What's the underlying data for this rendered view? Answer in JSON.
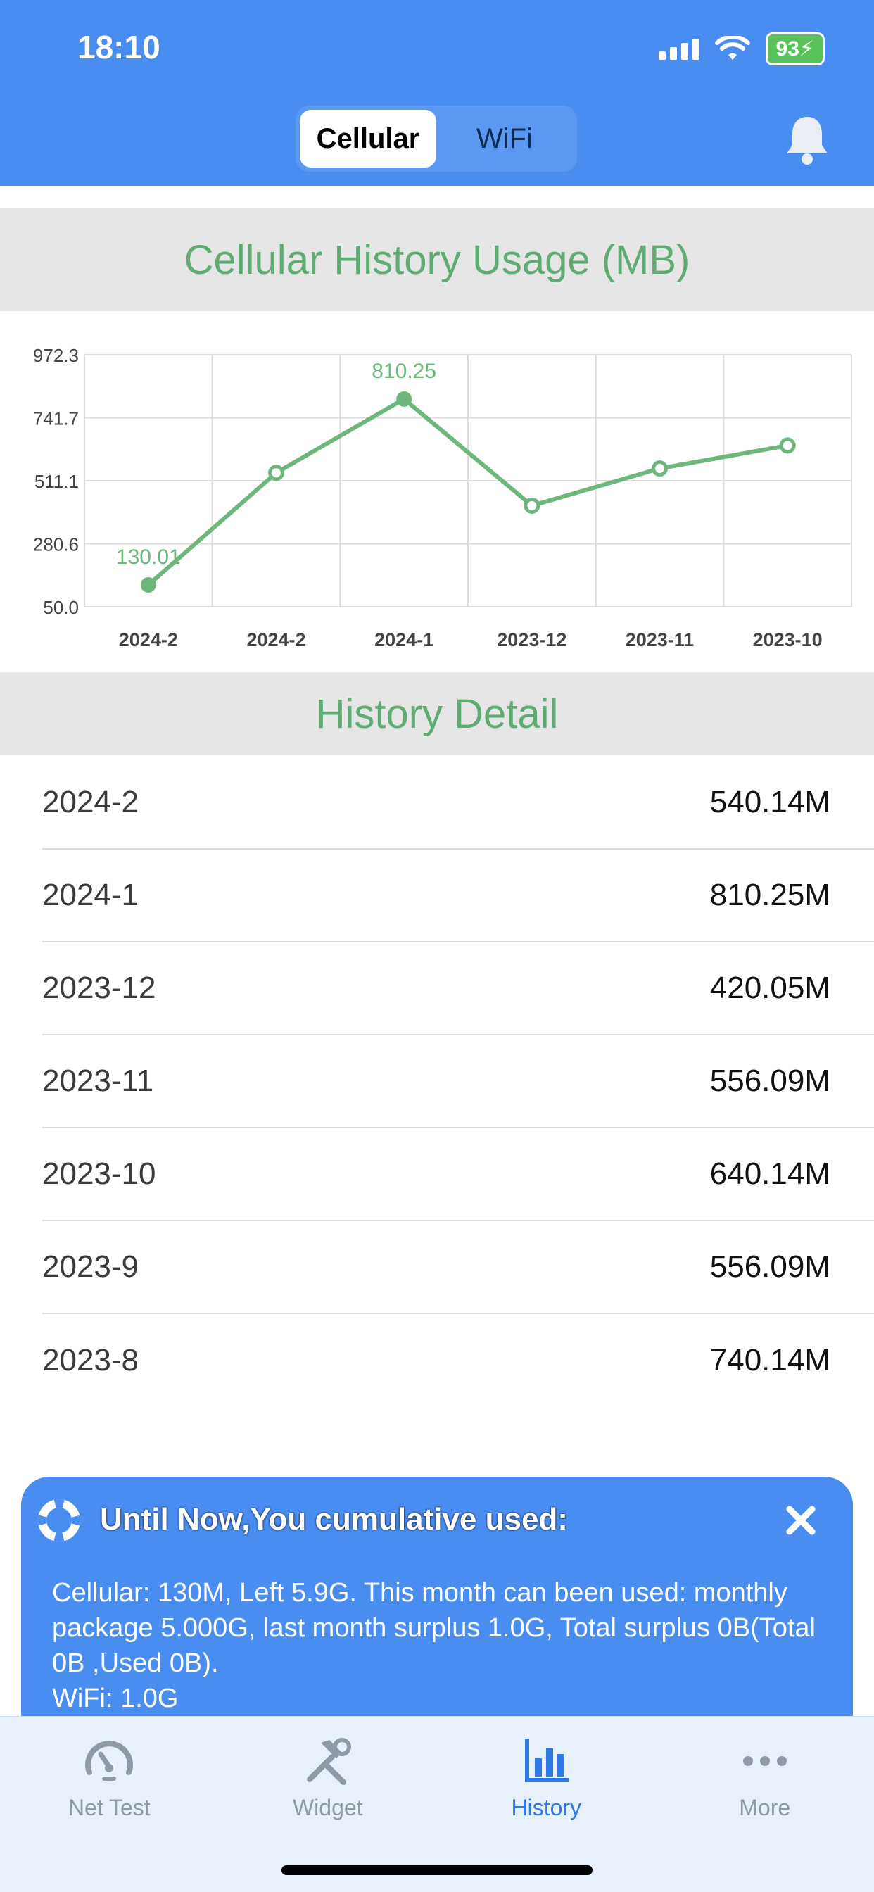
{
  "status": {
    "time": "18:10",
    "battery": "93"
  },
  "segments": [
    "Cellular",
    "WiFi"
  ],
  "active_segment": 0,
  "chart_title": "Cellular History Usage (MB)",
  "chart_data": {
    "type": "line",
    "categories": [
      "2024-2",
      "2024-2",
      "2024-1",
      "2023-12",
      "2023-11",
      "2023-10"
    ],
    "values": [
      130.01,
      540.14,
      810.25,
      420.05,
      556.09,
      640.14
    ],
    "yticks": [
      "972.3",
      "741.7",
      "511.1",
      "280.6",
      "50.0"
    ],
    "ylim": [
      50.0,
      972.3
    ],
    "labeled_points": [
      0,
      2
    ],
    "series_color": "#6db77c",
    "grid": true
  },
  "detail_title": "History Detail",
  "history": [
    {
      "month": "2024-2",
      "value": "540.14M"
    },
    {
      "month": "2024-1",
      "value": "810.25M"
    },
    {
      "month": "2023-12",
      "value": "420.05M"
    },
    {
      "month": "2023-11",
      "value": "556.09M"
    },
    {
      "month": "2023-10",
      "value": "640.14M"
    },
    {
      "month": "2023-9",
      "value": "556.09M"
    },
    {
      "month": "2023-8",
      "value": "740.14M"
    }
  ],
  "banner": {
    "title": "Until Now,You cumulative used:",
    "line1": "Cellular: 130M, Left 5.9G. This month can been used: monthly package 5.000G, last month surplus 1.0G, Total surplus 0B(Total 0B ,Used 0B).",
    "line2": "WiFi: 1.0G"
  },
  "tabs": [
    {
      "label": "Net Test",
      "icon": "speedometer-icon"
    },
    {
      "label": "Widget",
      "icon": "tools-icon"
    },
    {
      "label": "History",
      "icon": "bar-chart-icon"
    },
    {
      "label": "More",
      "icon": "more-dots-icon"
    }
  ],
  "active_tab": 2,
  "colors": {
    "header": "#4a8df0",
    "accent_green": "#5eab73",
    "tab_active": "#2f79e6"
  }
}
